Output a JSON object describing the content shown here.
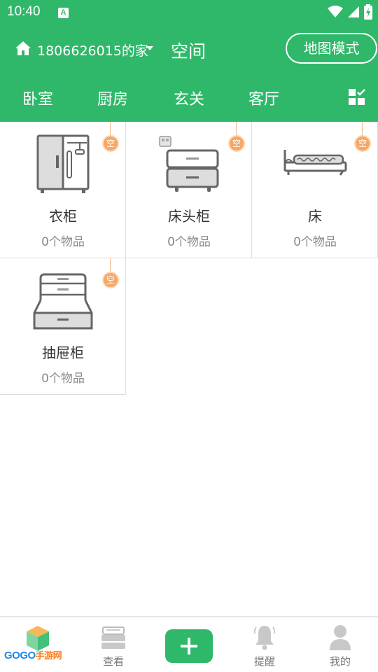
{
  "status_bar": {
    "time": "10:40",
    "notification_glyph": "A"
  },
  "header": {
    "home_name": "1806626015的家",
    "title": "空间",
    "map_mode_label": "地图模式",
    "accent_color": "#2fb86a"
  },
  "tabs": [
    {
      "label": "卧室",
      "active": true
    },
    {
      "label": "厨房",
      "active": false
    },
    {
      "label": "玄关",
      "active": false
    },
    {
      "label": "客厅",
      "active": false
    }
  ],
  "grid": {
    "badge_text": "空",
    "items": [
      {
        "name": "衣柜",
        "count": "0个物品",
        "icon": "wardrobe-icon"
      },
      {
        "name": "床头柜",
        "count": "0个物品",
        "icon": "nightstand-icon"
      },
      {
        "name": "床",
        "count": "0个物品",
        "icon": "bed-icon"
      },
      {
        "name": "抽屉柜",
        "count": "0个物品",
        "icon": "drawer-cabinet-icon"
      }
    ]
  },
  "bottom_nav": {
    "items": [
      {
        "label": "",
        "icon": "space-cube-icon"
      },
      {
        "label": "查看",
        "icon": "view-stack-icon"
      },
      {
        "label": "",
        "icon": "plus-icon"
      },
      {
        "label": "提醒",
        "icon": "bell-icon"
      },
      {
        "label": "我的",
        "icon": "user-icon"
      }
    ],
    "watermark_latin": "GOGO",
    "watermark_cn": "手游网"
  }
}
